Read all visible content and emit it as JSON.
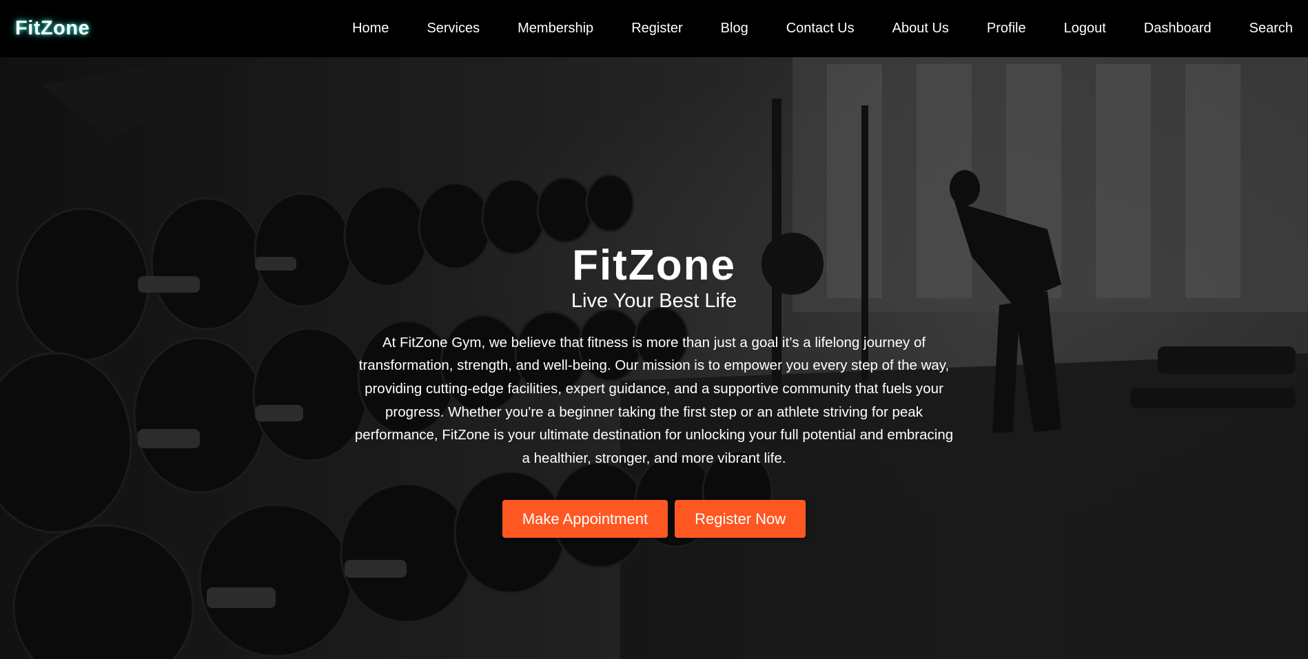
{
  "brand": {
    "name": "FitZone"
  },
  "nav": {
    "items": [
      {
        "label": "Home"
      },
      {
        "label": "Services"
      },
      {
        "label": "Membership"
      },
      {
        "label": "Register"
      },
      {
        "label": "Blog"
      },
      {
        "label": "Contact Us"
      },
      {
        "label": "About Us"
      },
      {
        "label": "Profile"
      },
      {
        "label": "Logout"
      },
      {
        "label": "Dashboard"
      },
      {
        "label": "Search"
      }
    ]
  },
  "hero": {
    "title": "FitZone",
    "subtitle": "Live Your Best Life",
    "description": "At FitZone Gym, we believe that fitness is more than just a goal it’s a lifelong journey of transformation, strength, and well-being. Our mission is to empower you every step of the way, providing cutting-edge facilities, expert guidance, and a supportive community that fuels your progress. Whether you're a beginner taking the first step or an athlete striving for peak performance, FitZone is your ultimate destination for unlocking your full potential and embracing a healthier, stronger, and more vibrant life.",
    "primary_button": "Make Appointment",
    "secondary_button": "Register Now"
  },
  "colors": {
    "accent": "#ff5722",
    "navbar": "#000000",
    "logo_glow": "#37e0d0"
  }
}
